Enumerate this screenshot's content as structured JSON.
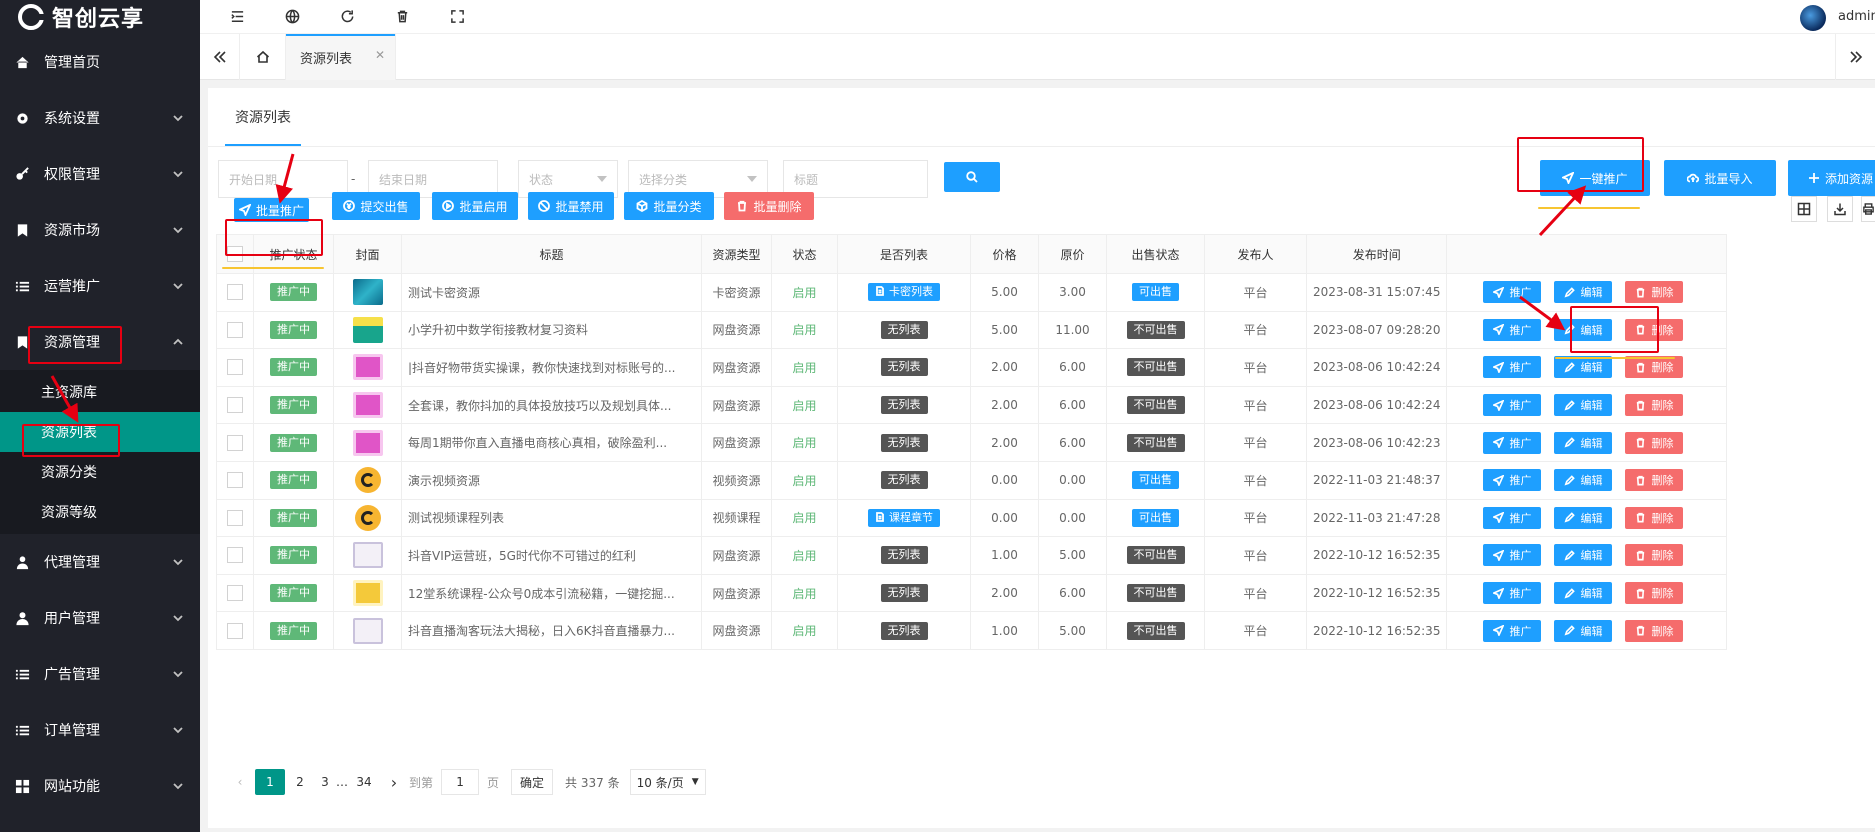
{
  "brand": {
    "name": "智创云享"
  },
  "sidebar": {
    "items": [
      {
        "label": "管理首页",
        "icon": "home-icon"
      },
      {
        "label": "系统设置",
        "icon": "gear-icon"
      },
      {
        "label": "权限管理",
        "icon": "key-icon"
      },
      {
        "label": "资源市场",
        "icon": "bookmark-icon"
      },
      {
        "label": "运营推广",
        "icon": "list-icon"
      },
      {
        "label": "资源管理",
        "icon": "bookmark-icon"
      },
      {
        "label": "代理管理",
        "icon": "user-group-icon"
      },
      {
        "label": "用户管理",
        "icon": "user-icon"
      },
      {
        "label": "广告管理",
        "icon": "list-icon"
      },
      {
        "label": "订单管理",
        "icon": "list-icon"
      },
      {
        "label": "网站功能",
        "icon": "grid-icon"
      }
    ],
    "sub_items": [
      "主资源库",
      "资源列表",
      "资源分类",
      "资源等级"
    ]
  },
  "header": {
    "user": "admin"
  },
  "tabs": {
    "current": "资源列表"
  },
  "card": {
    "title": "资源列表"
  },
  "filters": {
    "start_date": "开始日期",
    "end_date": "结束日期",
    "status": "状态",
    "category": "选择分类",
    "title": "标题",
    "dash": "-"
  },
  "actions": {
    "one_click": "一键推广",
    "batch_import": "批量导入",
    "add": "添加资源",
    "batch_promote": "批量推广",
    "submit_sale": "提交出售",
    "batch_enable": "批量启用",
    "batch_disable": "批量禁用",
    "batch_category": "批量分类",
    "batch_delete": "批量删除"
  },
  "table": {
    "headers": [
      "推广状态",
      "封面",
      "标题",
      "资源类型",
      "状态",
      "是否列表",
      "价格",
      "原价",
      "出售状态",
      "发布人",
      "发布时间"
    ],
    "op_labels": {
      "promote": "推广",
      "edit": "编辑",
      "delete": "删除"
    },
    "rows": [
      {
        "promo": "推广中",
        "cover": "cv1",
        "title": "测试卡密资源",
        "type": "卡密资源",
        "status": "启用",
        "list": "卡密列表",
        "list_style": "lblue",
        "price": "5.00",
        "orig": "3.00",
        "sale": "可出售",
        "sale_style": "lblue",
        "publisher": "平台",
        "time": "2023-08-31 15:07:45"
      },
      {
        "promo": "推广中",
        "cover": "cv2",
        "title": "小学升初中数学衔接教材复习资料",
        "type": "网盘资源",
        "status": "启用",
        "list": "无列表",
        "list_style": "dark",
        "price": "5.00",
        "orig": "11.00",
        "sale": "不可出售",
        "sale_style": "dark",
        "publisher": "平台",
        "time": "2023-08-07 09:28:20"
      },
      {
        "promo": "推广中",
        "cover": "cv3",
        "title": "|抖音好物带货实操课，教你快速找到对标账号的...",
        "type": "网盘资源",
        "status": "启用",
        "list": "无列表",
        "list_style": "dark",
        "price": "2.00",
        "orig": "6.00",
        "sale": "不可出售",
        "sale_style": "dark",
        "publisher": "平台",
        "time": "2023-08-06 10:42:24"
      },
      {
        "promo": "推广中",
        "cover": "cv3",
        "title": "全套课，教你抖加的具体投放技巧以及规划具体...",
        "type": "网盘资源",
        "status": "启用",
        "list": "无列表",
        "list_style": "dark",
        "price": "2.00",
        "orig": "6.00",
        "sale": "不可出售",
        "sale_style": "dark",
        "publisher": "平台",
        "time": "2023-08-06 10:42:24"
      },
      {
        "promo": "推广中",
        "cover": "cv3",
        "title": "每周1期带你直入直播电商核心真相，破除盈利...",
        "type": "网盘资源",
        "status": "启用",
        "list": "无列表",
        "list_style": "dark",
        "price": "2.00",
        "orig": "6.00",
        "sale": "不可出售",
        "sale_style": "dark",
        "publisher": "平台",
        "time": "2023-08-06 10:42:23"
      },
      {
        "promo": "推广中",
        "cover": "cv4",
        "title": "演示视频资源",
        "type": "视频资源",
        "status": "启用",
        "list": "无列表",
        "list_style": "dark",
        "price": "0.00",
        "orig": "0.00",
        "sale": "可出售",
        "sale_style": "lblue",
        "publisher": "平台",
        "time": "2022-11-03 21:48:37"
      },
      {
        "promo": "推广中",
        "cover": "cv4",
        "title": "测试视频课程列表",
        "type": "视频课程",
        "status": "启用",
        "list": "课程章节",
        "list_style": "lblue",
        "price": "0.00",
        "orig": "0.00",
        "sale": "可出售",
        "sale_style": "lblue",
        "publisher": "平台",
        "time": "2022-11-03 21:47:28"
      },
      {
        "promo": "推广中",
        "cover": "cv5",
        "title": "抖音VIP运营班，5G时代你不可错过的红利",
        "type": "网盘资源",
        "status": "启用",
        "list": "无列表",
        "list_style": "dark",
        "price": "1.00",
        "orig": "5.00",
        "sale": "不可出售",
        "sale_style": "dark",
        "publisher": "平台",
        "time": "2022-10-12 16:52:35"
      },
      {
        "promo": "推广中",
        "cover": "cv6",
        "title": "12堂系统课程-公众号0成本引流秘籍，一键挖掘...",
        "type": "网盘资源",
        "status": "启用",
        "list": "无列表",
        "list_style": "dark",
        "price": "2.00",
        "orig": "6.00",
        "sale": "不可出售",
        "sale_style": "dark",
        "publisher": "平台",
        "time": "2022-10-12 16:52:35"
      },
      {
        "promo": "推广中",
        "cover": "cv5",
        "title": "抖音直播淘客玩法大揭秘，日入6K抖音直播暴力...",
        "type": "网盘资源",
        "status": "启用",
        "list": "无列表",
        "list_style": "dark",
        "price": "1.00",
        "orig": "5.00",
        "sale": "不可出售",
        "sale_style": "dark",
        "publisher": "平台",
        "time": "2022-10-12 16:52:35"
      }
    ]
  },
  "pager": {
    "pages": [
      "1",
      "2",
      "3",
      "…",
      "34"
    ],
    "goto": "到第",
    "goto_value": "1",
    "page_unit": "页",
    "confirm": "确定",
    "total": "共 337 条",
    "per_page": "10 条/页"
  }
}
